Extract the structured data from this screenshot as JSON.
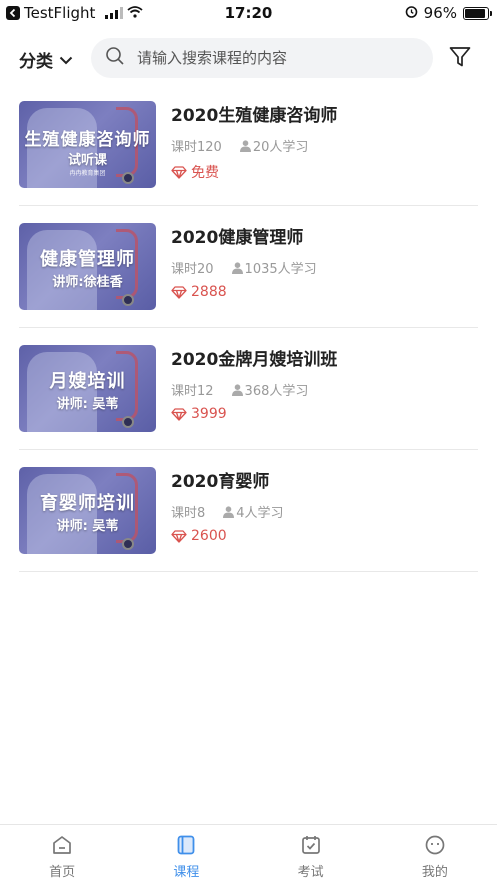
{
  "status_bar": {
    "back_app": "TestFlight",
    "time": "17:20",
    "battery": "96%"
  },
  "topbar": {
    "category_label": "分类",
    "search_placeholder": "请输入搜索课程的内容"
  },
  "courses": [
    {
      "title": "2020生殖健康咨询师",
      "thumb_main": "生殖健康咨询师",
      "thumb_sub": "试听课",
      "thumb_org": "冉冉教育集团",
      "lessons": "课时120",
      "students": "20人学习",
      "price": "免费"
    },
    {
      "title": "2020健康管理师",
      "thumb_main": "健康管理师",
      "thumb_sub": "讲师:徐桂香",
      "lessons": "课时20",
      "students": "1035人学习",
      "price": "2888"
    },
    {
      "title": "2020金牌月嫂培训班",
      "thumb_main": "月嫂培训",
      "thumb_sub": "讲师:  吴苇",
      "lessons": "课时12",
      "students": "368人学习",
      "price": "3999"
    },
    {
      "title": "2020育婴师",
      "thumb_main": "育婴师培训",
      "thumb_sub": "讲师:  吴苇",
      "lessons": "课时8",
      "students": "4人学习",
      "price": "2600"
    }
  ],
  "tabbar": {
    "items": [
      {
        "label": "首页",
        "icon": "home-icon"
      },
      {
        "label": "课程",
        "icon": "book-icon",
        "active": true
      },
      {
        "label": "考试",
        "icon": "calendar-check-icon"
      },
      {
        "label": "我的",
        "icon": "smiley-icon"
      }
    ]
  },
  "colors": {
    "accent": "#3f8fea",
    "price": "#d9534f",
    "thumb": "#6366ae"
  }
}
